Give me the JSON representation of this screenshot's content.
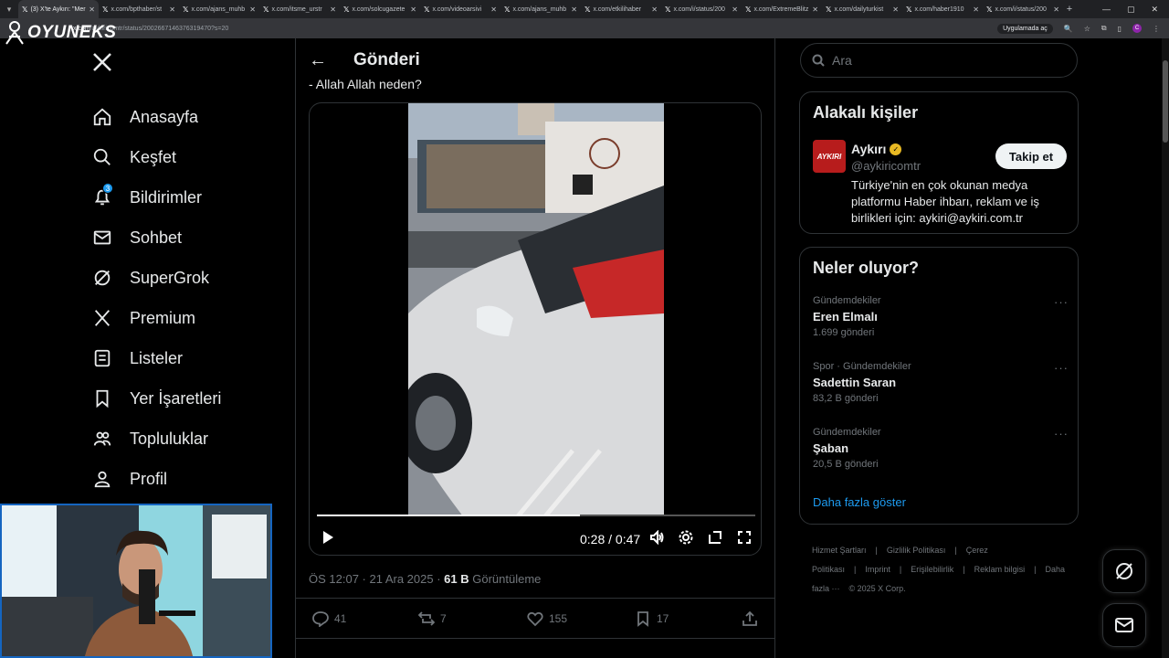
{
  "browser": {
    "tabs": [
      {
        "title": "(3) X'te Aykırı: \"Mer",
        "active": true
      },
      {
        "title": "x.com/bpthaber/st"
      },
      {
        "title": "x.com/ajans_muhb"
      },
      {
        "title": "x.com/itsme_urstr"
      },
      {
        "title": "x.com/solcugazete"
      },
      {
        "title": "x.com/videoarsivi"
      },
      {
        "title": "x.com/ajans_muhb"
      },
      {
        "title": "x.com/etkilihaber"
      },
      {
        "title": "x.com/i/status/200"
      },
      {
        "title": "x.com/ExtremeBlitz"
      },
      {
        "title": "x.com/dailyturkist"
      },
      {
        "title": "x.com/haber1910"
      },
      {
        "title": "x.com/i/status/200"
      }
    ],
    "url_domain": "x.com",
    "url_path": "/aykiricomtr/status/2002667146376319470?s=20",
    "apps_label": "Uygulamada aç"
  },
  "overlay": {
    "brand_text": "OYUNEKS"
  },
  "nav": {
    "items": [
      {
        "label": "Anasayfa",
        "icon": "home-icon"
      },
      {
        "label": "Keşfet",
        "icon": "search-icon"
      },
      {
        "label": "Bildirimler",
        "icon": "bell-icon",
        "badge": "3"
      },
      {
        "label": "Sohbet",
        "icon": "mail-icon"
      },
      {
        "label": "SuperGrok",
        "icon": "grok-icon"
      },
      {
        "label": "Premium",
        "icon": "x-icon"
      },
      {
        "label": "Listeler",
        "icon": "list-icon"
      },
      {
        "label": "Yer İşaretleri",
        "icon": "bookmark-icon"
      },
      {
        "label": "Topluluklar",
        "icon": "people-icon"
      },
      {
        "label": "Profil",
        "icon": "person-icon"
      }
    ]
  },
  "post": {
    "header_title": "Gönderi",
    "text": "- Allah Allah neden?",
    "video": {
      "current": "0:28",
      "duration": "0:47",
      "progress": 0.6
    },
    "time": "ÖS 12:07 · 21 Ara 2025 · ",
    "views": "61 B",
    "views_label": " Görüntüleme",
    "stats": {
      "replies": "41",
      "reposts": "7",
      "likes": "155",
      "bookmarks": "17"
    }
  },
  "sidebar": {
    "search_placeholder": "Ara",
    "related_title": "Alakalı kişiler",
    "account": {
      "name": "Aykırı",
      "handle": "@aykiricomtr",
      "bio": "Türkiye'nin en çok okunan medya platformu Haber ihbarı, reklam ve iş birlikleri için: aykiri@aykiri.com.tr",
      "avatar_text": "AYKIRI",
      "follow_label": "Takip et"
    },
    "trends_title": "Neler oluyor?",
    "trends": [
      {
        "category": "Gündemdekiler",
        "name": "Eren Elmalı",
        "count": "1.699 gönderi"
      },
      {
        "category": "Spor · Gündemdekiler",
        "name": "Sadettin Saran",
        "count": "83,2 B gönderi"
      },
      {
        "category": "Gündemdekiler",
        "name": "Şaban",
        "count": "20,5 B gönderi"
      }
    ],
    "show_more": "Daha fazla göster",
    "footer": [
      "Hizmet Şartları",
      "|",
      "Gizlilik Politikası",
      "|",
      "Çerez Politikası",
      "|",
      "Imprint",
      "|",
      "Erişilebilirlik",
      "|",
      "Reklam bilgisi",
      "|",
      "Daha fazla ···",
      "© 2025 X Corp."
    ]
  },
  "colors": {
    "accent": "#1d9bf0",
    "background": "#000000",
    "text": "#e7e9ea",
    "muted": "#71767b",
    "border": "#2f3336",
    "cam_border": "#1565c0"
  }
}
